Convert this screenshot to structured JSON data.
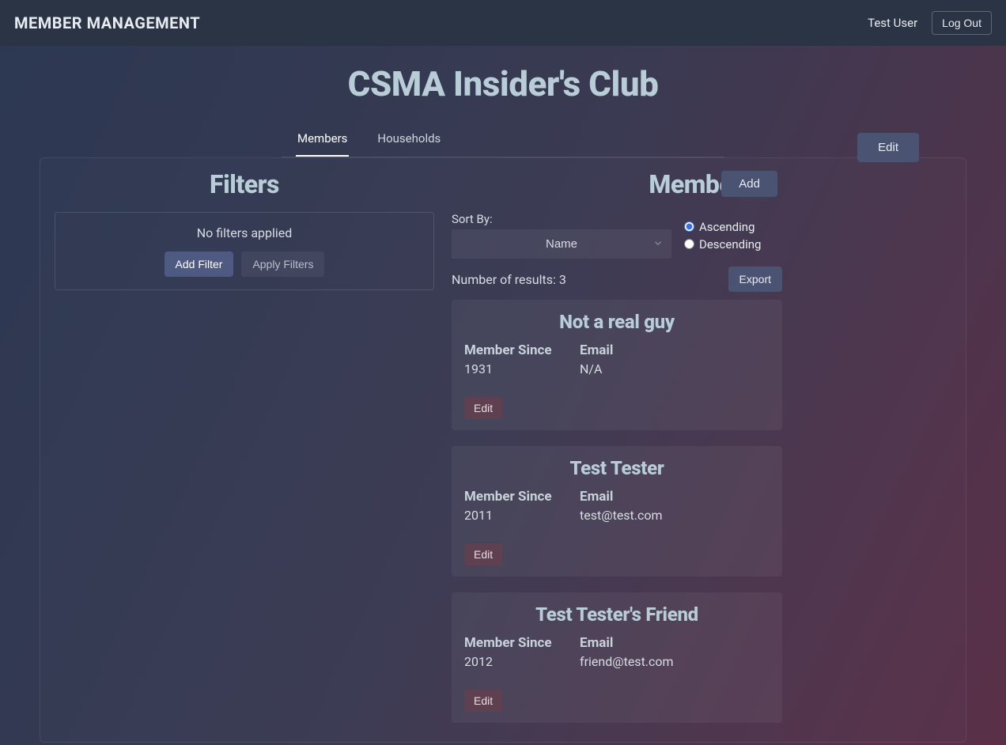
{
  "topbar": {
    "title": "MEMBER MANAGEMENT",
    "user": "Test User",
    "logout": "Log Out"
  },
  "club": {
    "title": "CSMA Insider's Club",
    "edit": "Edit"
  },
  "tabs": {
    "members": "Members",
    "households": "Households"
  },
  "filters": {
    "title": "Filters",
    "none": "No filters applied",
    "add": "Add Filter",
    "apply": "Apply Filters"
  },
  "members": {
    "title": "Members",
    "add": "Add",
    "sort_label": "Sort By:",
    "sort_value": "Name",
    "asc": "Ascending",
    "desc": "Descending",
    "results_prefix": "Number of results: ",
    "results_count": "3",
    "export": "Export",
    "field_member_since": "Member Since",
    "field_email": "Email",
    "edit": "Edit",
    "cards": [
      {
        "name": "Not a real guy",
        "since": "1931",
        "email": "N/A"
      },
      {
        "name": "Test Tester",
        "since": "2011",
        "email": "test@test.com"
      },
      {
        "name": "Test Tester's Friend",
        "since": "2012",
        "email": "friend@test.com"
      }
    ]
  }
}
